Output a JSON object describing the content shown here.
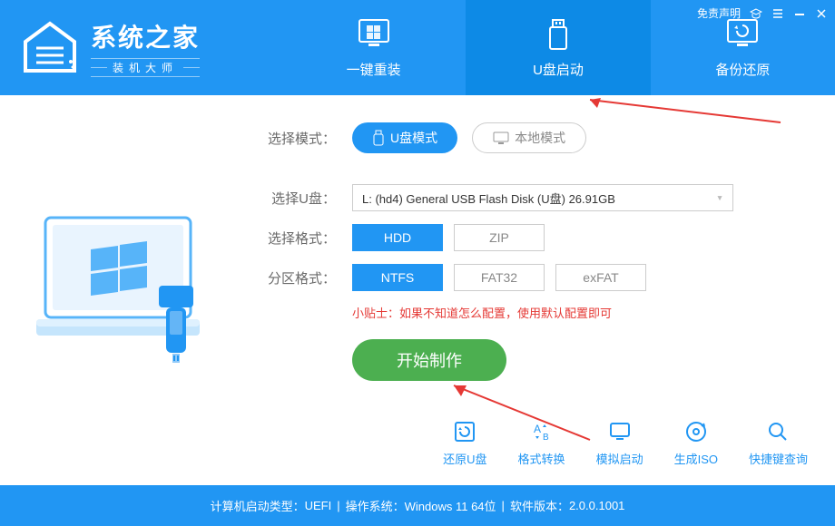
{
  "header": {
    "logo_title": "系统之家",
    "logo_subtitle": "装机大师",
    "disclaimer": "免责声明",
    "tabs": [
      {
        "label": "一键重装"
      },
      {
        "label": "U盘启动"
      },
      {
        "label": "备份还原"
      }
    ]
  },
  "mode": {
    "label": "选择模式：",
    "usb": "U盘模式",
    "local": "本地模式"
  },
  "usb_select": {
    "label": "选择U盘：",
    "value": "L: (hd4) General USB Flash Disk (U盘) 26.91GB"
  },
  "format_select": {
    "label": "选择格式：",
    "options": [
      "HDD",
      "ZIP"
    ]
  },
  "partition": {
    "label": "分区格式：",
    "options": [
      "NTFS",
      "FAT32",
      "exFAT"
    ]
  },
  "tip_text": "小贴士：如果不知道怎么配置，使用默认配置即可",
  "start_button": "开始制作",
  "tools": [
    {
      "label": "还原U盘"
    },
    {
      "label": "格式转换"
    },
    {
      "label": "模拟启动"
    },
    {
      "label": "生成ISO"
    },
    {
      "label": "快捷键查询"
    }
  ],
  "footer": {
    "boot_type_label": "计算机启动类型：",
    "boot_type": "UEFI",
    "os_label": "操作系统：",
    "os": "Windows 11 64位",
    "version_label": "软件版本：",
    "version": "2.0.0.1001"
  }
}
